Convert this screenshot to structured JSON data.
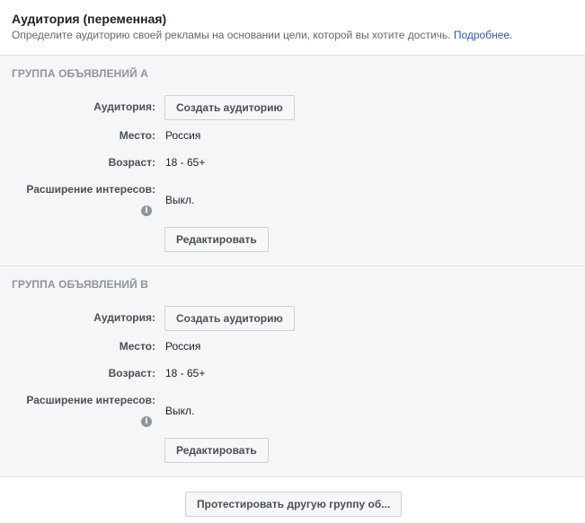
{
  "header": {
    "title": "Аудитория (переменная)",
    "subtitle": "Определите аудиторию своей рекламы на основании цели, которой вы хотите достичь.",
    "link": "Подробнее."
  },
  "groups": [
    {
      "title": "ГРУППА ОБЪЯВЛЕНИЙ A",
      "audience_label": "Аудитория:",
      "audience_button": "Создать аудиторию",
      "location_label": "Место:",
      "location_value": "Россия",
      "age_label": "Возраст:",
      "age_value": "18 - 65+",
      "interests_label": "Расширение интересов:",
      "interests_value": "Выкл.",
      "edit_button": "Редактировать"
    },
    {
      "title": "ГРУППА ОБЪЯВЛЕНИЙ B",
      "audience_label": "Аудитория:",
      "audience_button": "Создать аудиторию",
      "location_label": "Место:",
      "location_value": "Россия",
      "age_label": "Возраст:",
      "age_value": "18 - 65+",
      "interests_label": "Расширение интересов:",
      "interests_value": "Выкл.",
      "edit_button": "Редактировать"
    }
  ],
  "footer": {
    "test_button": "Протестировать другую группу об..."
  }
}
